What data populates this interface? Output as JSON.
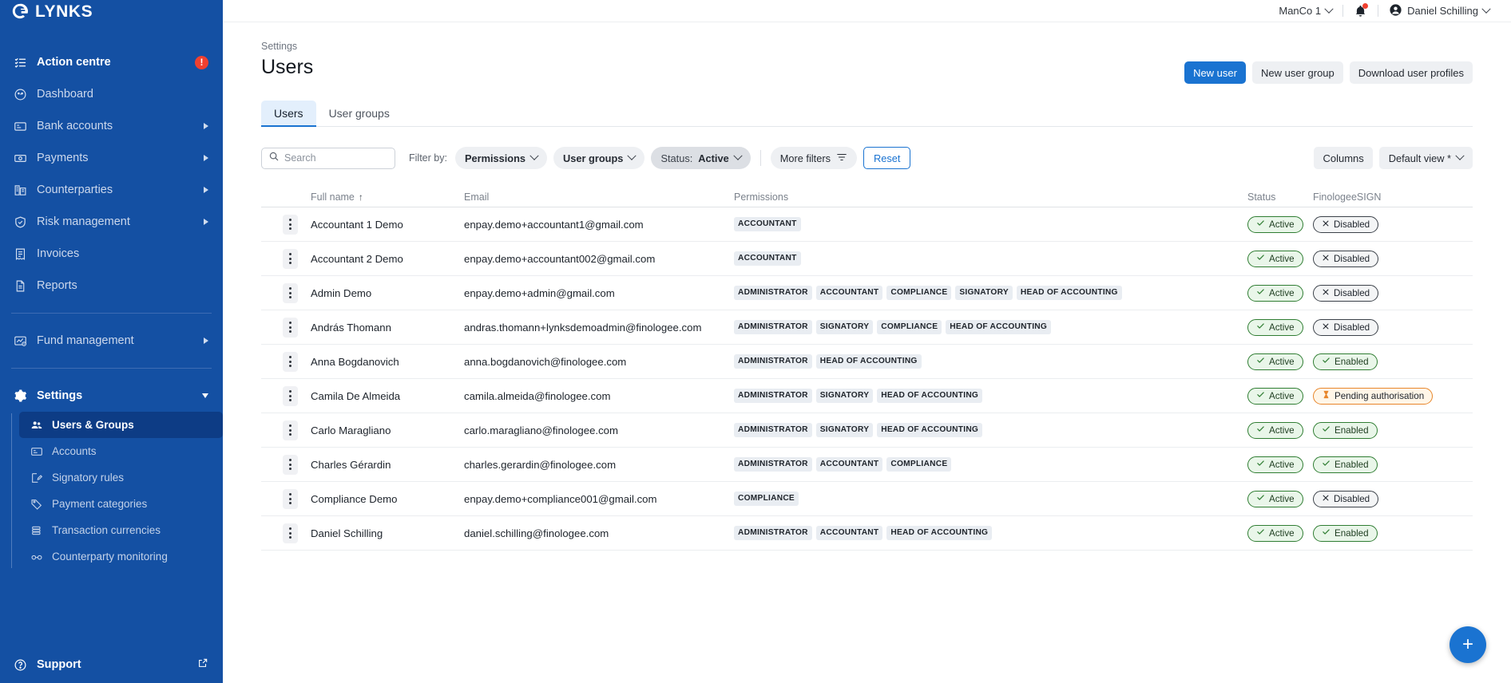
{
  "brand": {
    "name": "LYNKS",
    "logo_icon": "lynks-logo-icon",
    "sidebar_color": "#1450a3",
    "accent_color": "#1a73d1"
  },
  "sidebar": {
    "items": [
      {
        "label": "Action centre",
        "icon": "checklist-icon",
        "badge": "!",
        "expandable": false
      },
      {
        "label": "Dashboard",
        "icon": "speedometer-icon",
        "expandable": false
      },
      {
        "label": "Bank accounts",
        "icon": "card-icon",
        "expandable": true
      },
      {
        "label": "Payments",
        "icon": "banknote-icon",
        "expandable": true
      },
      {
        "label": "Counterparties",
        "icon": "building-icon",
        "expandable": true
      },
      {
        "label": "Risk management",
        "icon": "shield-check-icon",
        "expandable": true
      },
      {
        "label": "Invoices",
        "icon": "invoice-icon",
        "expandable": false
      },
      {
        "label": "Reports",
        "icon": "document-icon",
        "expandable": false
      }
    ],
    "fund_management": {
      "label": "Fund management",
      "icon": "fund-chart-icon",
      "expandable": true
    },
    "settings": {
      "label": "Settings",
      "icon": "gear-icon",
      "expanded": true
    },
    "settings_children": [
      {
        "label": "Users & Groups",
        "icon": "users-icon",
        "active": true
      },
      {
        "label": "Accounts",
        "icon": "card-icon",
        "active": false
      },
      {
        "label": "Signatory rules",
        "icon": "signature-icon",
        "active": false
      },
      {
        "label": "Payment categories",
        "icon": "tag-icon",
        "active": false
      },
      {
        "label": "Transaction currencies",
        "icon": "coins-icon",
        "active": false
      },
      {
        "label": "Counterparty monitoring",
        "icon": "binoculars-icon",
        "active": false
      }
    ],
    "support": {
      "label": "Support",
      "icon": "question-circle-icon",
      "external_icon": "external-link-icon"
    }
  },
  "topbar": {
    "company": "ManCo 1",
    "notifications_icon": "bell-icon",
    "has_notification": true,
    "user": "Daniel Schilling",
    "user_icon": "account-circle-icon"
  },
  "header": {
    "breadcrumb": "Settings",
    "title": "Users",
    "actions": [
      {
        "label": "New user",
        "style": "primary"
      },
      {
        "label": "New user group",
        "style": "ghost"
      },
      {
        "label": "Download user profiles",
        "style": "ghost"
      }
    ]
  },
  "tabs": [
    {
      "label": "Users",
      "active": true
    },
    {
      "label": "User groups",
      "active": false
    }
  ],
  "toolbar": {
    "search_placeholder": "Search",
    "search_value": "",
    "search_icon": "search-icon",
    "filter_by_label": "Filter by:",
    "filters": [
      {
        "key": "",
        "value": "Permissions",
        "selected": false
      },
      {
        "key": "",
        "value": "User groups",
        "selected": false
      },
      {
        "key": "Status:",
        "value": "Active",
        "selected": true
      }
    ],
    "more_filters_label": "More filters",
    "more_filters_icon": "filter-icon",
    "reset_label": "Reset",
    "columns_label": "Columns",
    "view_label": "Default view *"
  },
  "table": {
    "columns": [
      "Full name",
      "Email",
      "Permissions",
      "Status",
      "FinologeeSIGN"
    ],
    "sort_column": "Full name",
    "sort_direction": "asc",
    "sort_icon": "arrow-up-icon",
    "row_menu_icon": "kebab-menu-icon",
    "rows": [
      {
        "full_name": "Accountant 1 Demo",
        "email": "enpay.demo+accountant1@gmail.com",
        "permissions": [
          "ACCOUNTANT"
        ],
        "status": "Active",
        "status_type": "active",
        "sign": "Disabled",
        "sign_type": "disabled"
      },
      {
        "full_name": "Accountant 2 Demo",
        "email": "enpay.demo+accountant002@gmail.com",
        "permissions": [
          "ACCOUNTANT"
        ],
        "status": "Active",
        "status_type": "active",
        "sign": "Disabled",
        "sign_type": "disabled"
      },
      {
        "full_name": "Admin Demo",
        "email": "enpay.demo+admin@gmail.com",
        "permissions": [
          "ADMINISTRATOR",
          "ACCOUNTANT",
          "COMPLIANCE",
          "SIGNATORY",
          "HEAD OF ACCOUNTING"
        ],
        "status": "Active",
        "status_type": "active",
        "sign": "Disabled",
        "sign_type": "disabled"
      },
      {
        "full_name": "András Thomann",
        "email": "andras.thomann+lynksdemoadmin@finologee.com",
        "permissions": [
          "ADMINISTRATOR",
          "SIGNATORY",
          "COMPLIANCE",
          "HEAD OF ACCOUNTING"
        ],
        "status": "Active",
        "status_type": "active",
        "sign": "Disabled",
        "sign_type": "disabled"
      },
      {
        "full_name": "Anna Bogdanovich",
        "email": "anna.bogdanovich@finologee.com",
        "permissions": [
          "ADMINISTRATOR",
          "HEAD OF ACCOUNTING"
        ],
        "status": "Active",
        "status_type": "active",
        "sign": "Enabled",
        "sign_type": "enabled"
      },
      {
        "full_name": "Camila De Almeida",
        "email": "camila.almeida@finologee.com",
        "permissions": [
          "ADMINISTRATOR",
          "SIGNATORY",
          "HEAD OF ACCOUNTING"
        ],
        "status": "Active",
        "status_type": "active",
        "sign": "Pending authorisation",
        "sign_type": "pending"
      },
      {
        "full_name": "Carlo Maragliano",
        "email": "carlo.maragliano@finologee.com",
        "permissions": [
          "ADMINISTRATOR",
          "SIGNATORY",
          "HEAD OF ACCOUNTING"
        ],
        "status": "Active",
        "status_type": "active",
        "sign": "Enabled",
        "sign_type": "enabled"
      },
      {
        "full_name": "Charles Gérardin",
        "email": "charles.gerardin@finologee.com",
        "permissions": [
          "ADMINISTRATOR",
          "ACCOUNTANT",
          "COMPLIANCE"
        ],
        "status": "Active",
        "status_type": "active",
        "sign": "Enabled",
        "sign_type": "enabled"
      },
      {
        "full_name": "Compliance Demo",
        "email": "enpay.demo+compliance001@gmail.com",
        "permissions": [
          "COMPLIANCE"
        ],
        "status": "Active",
        "status_type": "active",
        "sign": "Disabled",
        "sign_type": "disabled"
      },
      {
        "full_name": "Daniel Schilling",
        "email": "daniel.schilling@finologee.com",
        "permissions": [
          "ADMINISTRATOR",
          "ACCOUNTANT",
          "HEAD OF ACCOUNTING"
        ],
        "status": "Active",
        "status_type": "active",
        "sign": "Enabled",
        "sign_type": "enabled"
      }
    ]
  },
  "fab": {
    "label": "+",
    "icon": "plus-icon"
  }
}
